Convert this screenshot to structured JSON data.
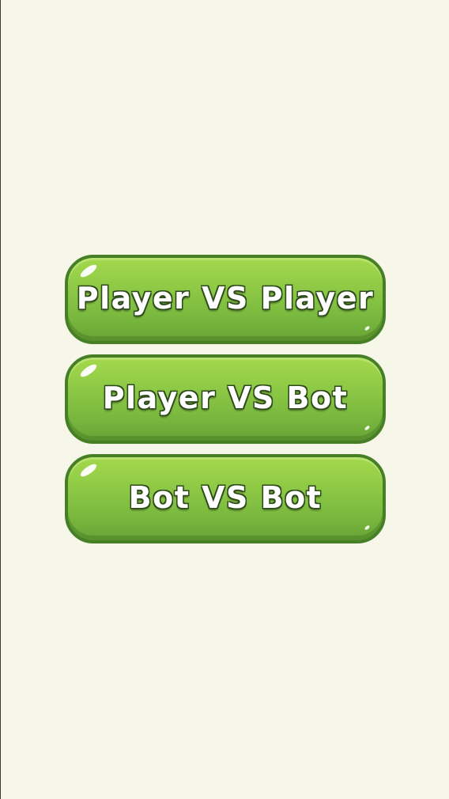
{
  "menu": {
    "buttons": [
      {
        "label": "Player VS Player"
      },
      {
        "label": "Player VS Bot"
      },
      {
        "label": "Bot VS Bot"
      }
    ]
  },
  "colors": {
    "background": "#f6f6e9",
    "button_top": "#a4d84c",
    "button_bottom": "#67a335",
    "button_border": "#467f26",
    "label_text": "#ffffff",
    "label_outline": "#2e4a1c"
  }
}
